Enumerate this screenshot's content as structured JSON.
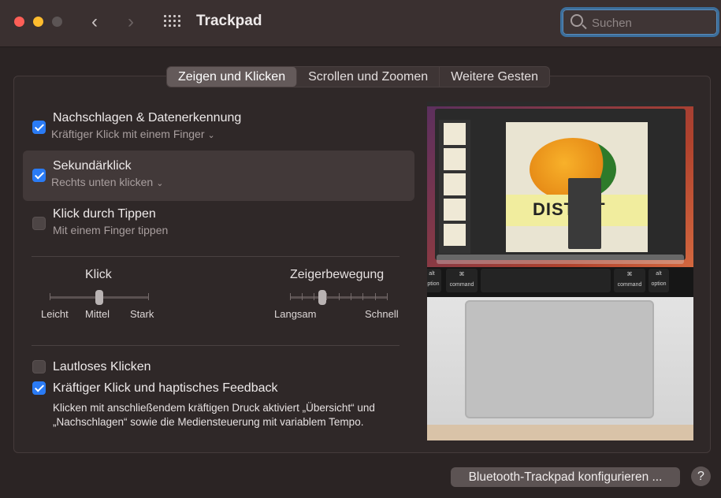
{
  "window": {
    "title": "Trackpad",
    "back_glyph": "‹",
    "forward_glyph": "›"
  },
  "search": {
    "placeholder": "Suchen",
    "value": ""
  },
  "tabs": [
    {
      "label": "Zeigen und Klicken",
      "active": true
    },
    {
      "label": "Scrollen und Zoomen",
      "active": false
    },
    {
      "label": "Weitere Gesten",
      "active": false
    }
  ],
  "options": [
    {
      "title": "Nachschlagen & Datenerkennung",
      "subtitle": "Kräftiger Klick mit einem Finger",
      "checked": true,
      "has_menu": true
    },
    {
      "title": "Sekundärklick",
      "subtitle": "Rechts unten klicken",
      "checked": true,
      "has_menu": true
    },
    {
      "title": "Klick durch Tippen",
      "subtitle": "Mit einem Finger tippen",
      "checked": false,
      "has_menu": false
    }
  ],
  "sliders": {
    "click": {
      "title": "Klick",
      "min_label": "Leicht",
      "mid_label": "Mittel",
      "max_label": "Stark",
      "value_fraction": 0.5
    },
    "pointer": {
      "title": "Zeigerbewegung",
      "min_label": "Langsam",
      "max_label": "Schnell",
      "value_fraction": 0.33
    }
  },
  "bottom_options": [
    {
      "title": "Lautloses Klicken",
      "checked": false
    },
    {
      "title": "Kräftiger Klick und haptisches Feedback",
      "checked": true
    }
  ],
  "force_click_description": "Klicken mit anschließendem kräftigen Druck aktiviert „Übersicht“ und „Nachschlagen“ sowie die Mediensteuerung mit variablem Tempo.",
  "preview": {
    "slide_word": "DISTICT",
    "keys": {
      "left_top": "alt",
      "left_bottom": "option",
      "cmd_symbol": "⌘",
      "cmd_label": "command"
    }
  },
  "buttons": {
    "configure": "Bluetooth-Trackpad konfigurieren ...",
    "help": "?"
  },
  "colors": {
    "accent": "#2a7bf5",
    "search_focus": "#3c6f9c"
  }
}
